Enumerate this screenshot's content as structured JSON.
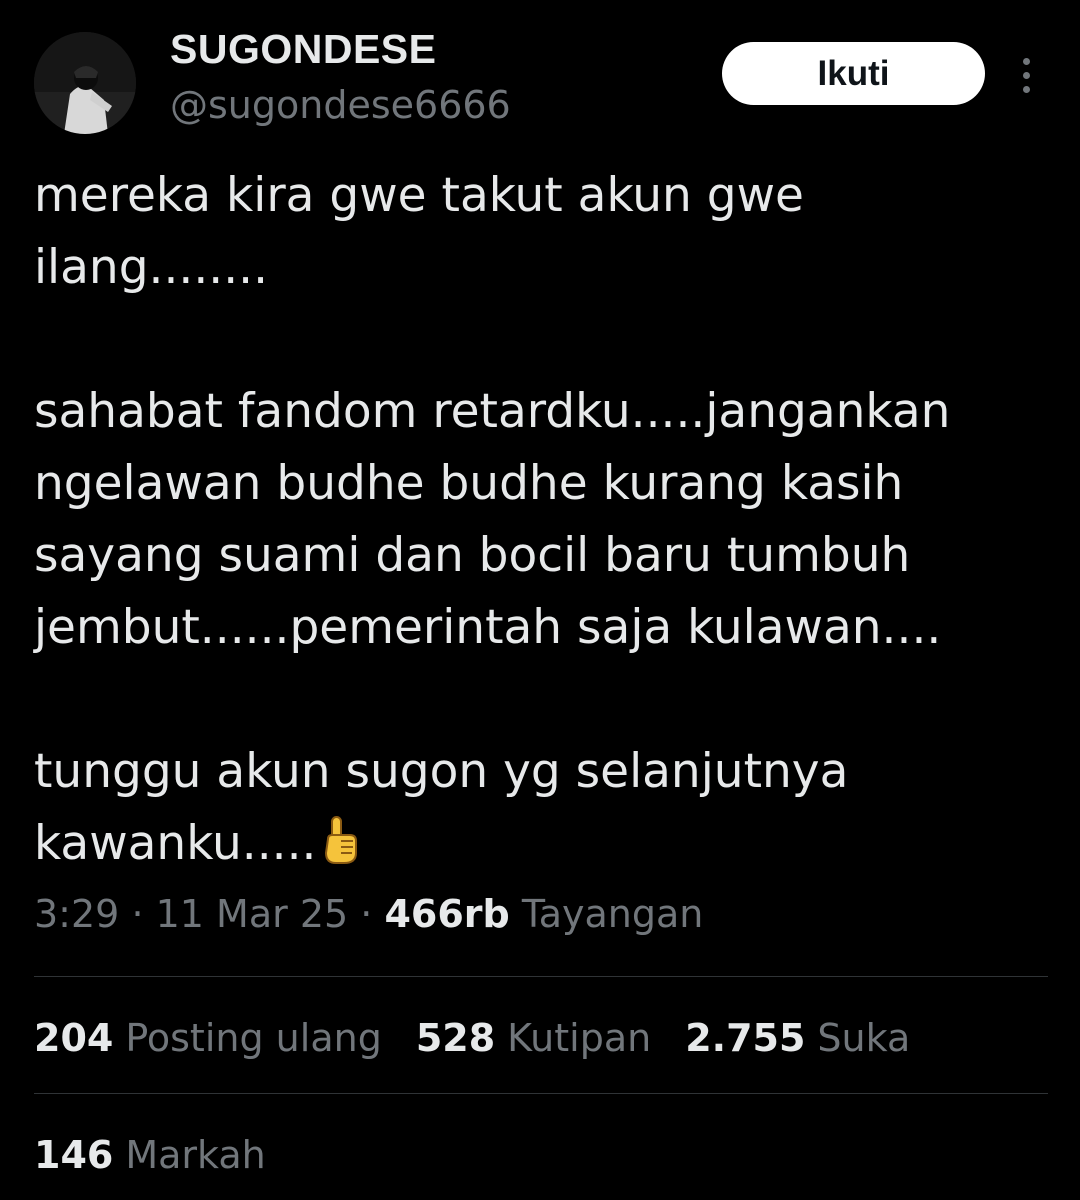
{
  "author": {
    "display_name": "SUGONDESE",
    "handle": "@sugondese6666"
  },
  "follow_button_label": "Ikuti",
  "tweet": {
    "lines": [
      "mereka kira gwe takut akun gwe",
      "ilang........",
      "",
      "sahabat fandom retardku.....jangankan",
      "ngelawan budhe budhe kurang kasih",
      "sayang suami dan bocil baru tumbuh",
      "jembut......pemerintah saja kulawan....",
      "",
      "tunggu akun sugon yg selanjutnya",
      "kawanku....."
    ],
    "emoji": "point-up-icon"
  },
  "meta": {
    "time": "3:29",
    "separator": "·",
    "date": "11 Mar 25",
    "views_count": "466rb",
    "views_label": "Tayangan"
  },
  "stats": {
    "reposts_count": "204",
    "reposts_label": "Posting ulang",
    "quotes_count": "528",
    "quotes_label": "Kutipan",
    "likes_count": "2.755",
    "likes_label": "Suka",
    "bookmarks_count": "146",
    "bookmarks_label": "Markah"
  },
  "colors": {
    "background": "#000000",
    "primary_text": "#e7e9ea",
    "secondary_text": "#71767b",
    "divider": "#2f3336",
    "button_bg": "#ffffff"
  }
}
